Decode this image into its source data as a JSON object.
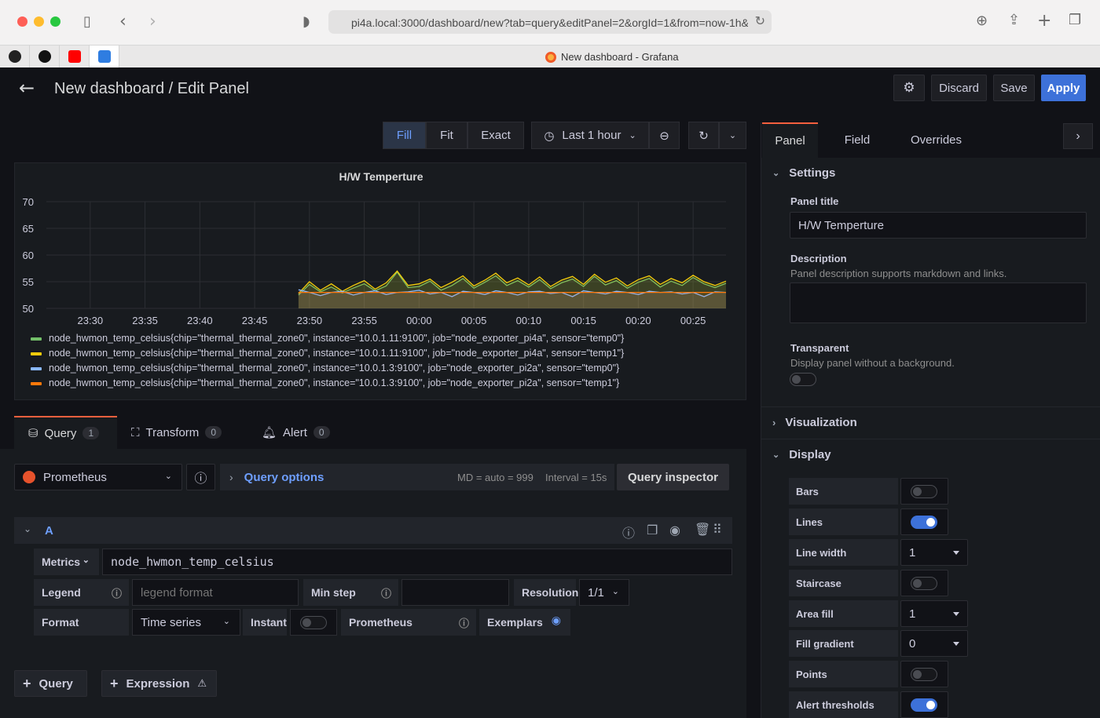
{
  "browser": {
    "url": "pi4a.local:3000/dashboard/new?tab=query&editPanel=2&orgId=1&from=now-1h&to=now",
    "tab_title": "New dashboard - Grafana"
  },
  "header": {
    "title": "New dashboard / Edit Panel",
    "discard_label": "Discard",
    "save_label": "Save",
    "apply_label": "Apply"
  },
  "toolbar": {
    "fill_label": "Fill",
    "fit_label": "Fit",
    "exact_label": "Exact",
    "time_range": "Last 1 hour"
  },
  "panel": {
    "title": "H/W Temperture"
  },
  "chart_data": {
    "type": "line",
    "title": "H/W Temperture",
    "x_ticks": [
      "23:30",
      "23:35",
      "23:40",
      "23:45",
      "23:50",
      "23:55",
      "00:00",
      "00:05",
      "00:10",
      "00:15",
      "00:20",
      "00:25"
    ],
    "y_ticks": [
      50,
      55,
      60,
      65,
      70
    ],
    "ylim": [
      50,
      70
    ],
    "data_start": "23:49",
    "data_end": "00:28",
    "series": [
      {
        "name": "node_hwmon_temp_celsius{chip=\"thermal_thermal_zone0\", instance=\"10.0.1.11:9100\", job=\"node_exporter_pi4a\", sensor=\"temp0\"}",
        "color": "#73bf69",
        "values": [
          52.5,
          54.5,
          53.1,
          54.0,
          52.9,
          53.8,
          54.6,
          53.3,
          54.2,
          56.8,
          53.9,
          54.1,
          55.1,
          53.4,
          54.3,
          55.6,
          53.8,
          54.9,
          56.1,
          54.3,
          55.2,
          54.0,
          55.4,
          53.7,
          54.8,
          55.5,
          54.1,
          56.0,
          54.4,
          55.2,
          53.8,
          54.9,
          55.6,
          54.0,
          55.1,
          54.3,
          55.8,
          54.6,
          53.9,
          54.7
        ]
      },
      {
        "name": "node_hwmon_temp_celsius{chip=\"thermal_thermal_zone0\", instance=\"10.0.1.11:9100\", job=\"node_exporter_pi4a\", sensor=\"temp1\"}",
        "color": "#f2cc0c",
        "values": [
          52.8,
          55.0,
          53.4,
          54.6,
          53.2,
          54.3,
          55.2,
          53.6,
          54.8,
          57.0,
          54.3,
          54.6,
          55.5,
          53.9,
          54.9,
          56.1,
          54.2,
          55.3,
          56.6,
          54.8,
          55.7,
          54.4,
          55.9,
          54.1,
          55.3,
          56.0,
          54.5,
          56.4,
          54.9,
          55.7,
          54.2,
          55.4,
          56.1,
          54.5,
          55.6,
          54.8,
          56.2,
          55.0,
          54.3,
          55.1
        ]
      },
      {
        "name": "node_hwmon_temp_celsius{chip=\"thermal_thermal_zone0\", instance=\"10.0.1.3:9100\", job=\"node_exporter_pi2a\", sensor=\"temp0\"}",
        "color": "#8ab8ff",
        "values": [
          53.5,
          53.0,
          52.4,
          53.0,
          53.2,
          52.5,
          53.0,
          53.3,
          52.6,
          53.0,
          53.1,
          53.4,
          52.7,
          53.0,
          52.2,
          53.2,
          53.0,
          52.6,
          53.3,
          53.0,
          52.5,
          53.1,
          53.2,
          52.8,
          53.0,
          52.2,
          53.3,
          53.0,
          52.7,
          53.2,
          53.0,
          52.6,
          53.2,
          53.0,
          53.1,
          52.7,
          53.0,
          52.2,
          53.1,
          53.0
        ]
      },
      {
        "name": "node_hwmon_temp_celsius{chip=\"thermal_thermal_zone0\", instance=\"10.0.1.3:9100\", job=\"node_exporter_pi2a\", sensor=\"temp1\"}",
        "color": "#ff780a",
        "values": [
          53.0,
          53.0,
          53.0,
          53.0,
          53.0,
          53.0,
          53.0,
          53.0,
          53.0,
          53.0,
          53.0,
          53.0,
          53.0,
          53.0,
          53.0,
          53.0,
          53.0,
          53.0,
          53.0,
          53.0,
          53.0,
          53.0,
          53.0,
          53.0,
          53.0,
          53.0,
          53.0,
          53.0,
          53.0,
          53.0,
          53.0,
          53.0,
          53.0,
          53.0,
          53.0,
          53.0,
          53.0,
          53.0,
          53.0,
          53.0
        ]
      }
    ],
    "grid": true,
    "legend_position": "bottom"
  },
  "query_tabs": [
    {
      "label": "Query",
      "count": "1"
    },
    {
      "label": "Transform",
      "count": "0"
    },
    {
      "label": "Alert",
      "count": "0"
    }
  ],
  "datasource": {
    "name": "Prometheus",
    "query_options_label": "Query options",
    "md_info": "MD = auto = 999",
    "interval_info": "Interval = 15s",
    "inspector_label": "Query inspector"
  },
  "query": {
    "ref_id": "A",
    "metrics_label": "Metrics",
    "metrics_value": "node_hwmon_temp_celsius",
    "legend_label": "Legend",
    "legend_placeholder": "legend format",
    "min_step_label": "Min step",
    "resolution_label": "Resolution",
    "resolution_value": "1/1",
    "format_label": "Format",
    "format_value": "Time series",
    "instant_label": "Instant",
    "prometheus_label": "Prometheus",
    "exemplars_label": "Exemplars"
  },
  "bottom": {
    "add_query_label": "Query",
    "add_expression_label": "Expression"
  },
  "options": {
    "tabs": [
      "Panel",
      "Field",
      "Overrides"
    ],
    "settings_header": "Settings",
    "panel_title_label": "Panel title",
    "panel_title_value": "H/W Temperture",
    "description_label": "Description",
    "description_help": "Panel description supports markdown and links.",
    "transparent_label": "Transparent",
    "transparent_help": "Display panel without a background.",
    "visualization_header": "Visualization",
    "display_header": "Display",
    "display_options": [
      {
        "label": "Bars",
        "kind": "toggle",
        "on": false
      },
      {
        "label": "Lines",
        "kind": "toggle",
        "on": true
      },
      {
        "label": "Line width",
        "kind": "select",
        "value": "1"
      },
      {
        "label": "Staircase",
        "kind": "toggle",
        "on": false
      },
      {
        "label": "Area fill",
        "kind": "select",
        "value": "1"
      },
      {
        "label": "Fill gradient",
        "kind": "select",
        "value": "0"
      },
      {
        "label": "Points",
        "kind": "toggle",
        "on": false
      },
      {
        "label": "Alert thresholds",
        "kind": "toggle",
        "on": true
      }
    ]
  }
}
